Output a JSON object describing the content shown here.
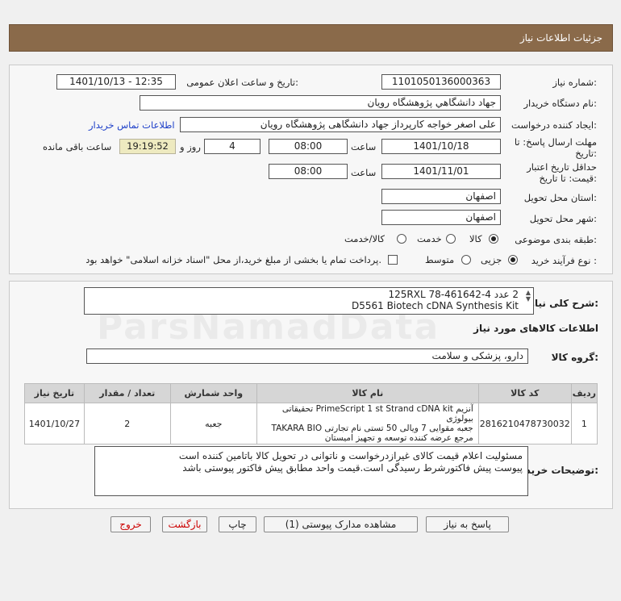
{
  "header": {
    "title": "جزئیات اطلاعات نیاز"
  },
  "form": {
    "need_number_label": "شماره نیاز:",
    "need_number": "1101050136000363",
    "announce_label": "تاریخ و ساعت اعلان عمومی:",
    "announce_value": "1401/10/13 - 12:35",
    "buyer_org_label": "نام دستگاه خریدار:",
    "buyer_org": "جهاد دانشگاهي پژوهشگاه رويان",
    "creator_label": "ایجاد کننده درخواست:",
    "creator": "علی اصغر خواجه کارپرداز جهاد دانشگاهی پژوهشگاه رویان",
    "contact_link": "اطلاعات تماس خریدار",
    "deadline_label": "مهلت ارسال پاسخ: تا تاریخ:",
    "deadline_date": "1401/10/18",
    "time_label": "ساعت",
    "deadline_time": "08:00",
    "days": "4",
    "days_label": "روز و",
    "remaining": "19:19:52",
    "remaining_label": "ساعت باقی مانده",
    "validity_label": "حداقل تاریخ اعتبار قیمت: تا تاریخ:",
    "validity_date": "1401/11/01",
    "validity_time": "08:00",
    "province_label": "استان محل تحویل:",
    "province": "اصفهان",
    "city_label": "شهر محل تحویل:",
    "city": "اصفهان",
    "category_label": "طبقه بندی موضوعی:",
    "cat_goods": "کالا",
    "cat_service": "خدمت",
    "cat_both": "کالا/خدمت",
    "process_label": "نوع فرآیند خرید :",
    "proc_partial": "جزیی",
    "proc_medium": "متوسط",
    "payment_note": "پرداخت تمام یا بخشی از مبلغ خرید،از محل \"اسناد خزانه اسلامی\" خواهد بود."
  },
  "details": {
    "summary_label": "شرح کلی نیاز:",
    "summary_line1": "2 عدد 4-461642-78 125RXL",
    "summary_line2": "D5561 Biotech cDNA Synthesis Kit",
    "goods_info_title": "اطلاعات کالاهای مورد نیاز",
    "group_label": "گروه کالا:",
    "group_value": "دارو، پزشکی و سلامت",
    "table": {
      "headers": [
        "ردیف",
        "کد کالا",
        "نام کالا",
        "واحد شمارش",
        "تعداد / مقدار",
        "تاریخ نیاز"
      ],
      "rows": [
        {
          "row": "1",
          "code": "2816210478730032",
          "name_1": "آنزیم PrimeScript 1 st Strand cDNA kit تحقیقاتی بیولوژی",
          "name_2": "جعبه مقوایی 7 ویالی 50 تستی نام تجارتی TAKARA BIO",
          "name_3": "مرجع عرضه کننده توسعه و تجهیز امیستان",
          "unit": "جعبه",
          "qty": "2",
          "date": "1401/10/27"
        }
      ]
    },
    "notes_label": "توضیحات خریدار:",
    "notes_line1": "مسئولیت اعلام قیمت کالای غیرازدرخواست و ناتوانی در تحویل کالا باتامین کننده است",
    "notes_line2": "پیوست پیش فاکتورشرط رسیدگی است.قیمت واحد مطابق پیش فاکتور پیوستی باشد"
  },
  "buttons": {
    "reply": "پاسخ به نیاز",
    "attachments": "مشاهده مدارک پیوستی (1)",
    "print": "چاپ",
    "back": "بازگشت",
    "exit": "خروج"
  }
}
